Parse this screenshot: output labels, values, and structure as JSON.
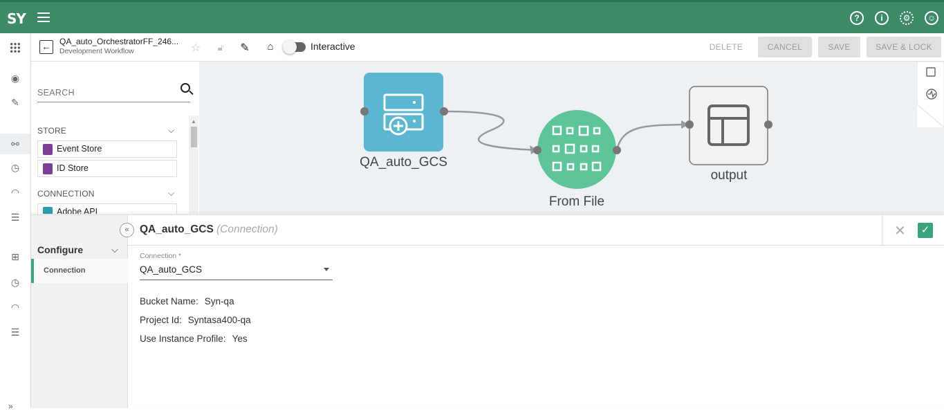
{
  "app": {
    "logo_text": "SY"
  },
  "topbar": {
    "icons": [
      "help-icon",
      "info-icon",
      "settings-icon",
      "account-icon"
    ]
  },
  "toolbar": {
    "title": "QA_auto_OrchestratorFF_246...",
    "subtitle": "Development Workflow",
    "toggle_label": "Interactive",
    "toggle_on": false,
    "delete_label": "DELETE",
    "cancel_label": "CANCEL",
    "save_label": "SAVE",
    "save_lock_label": "SAVE & LOCK"
  },
  "palette": {
    "search_placeholder": "SEARCH",
    "sections": [
      {
        "title": "STORE",
        "items": [
          "Event Store",
          "ID Store"
        ]
      },
      {
        "title": "CONNECTION",
        "items": [
          "Adobe API"
        ]
      }
    ]
  },
  "canvas": {
    "nodes": [
      {
        "label": "QA_auto_GCS",
        "kind": "connection",
        "color": "#5bb6cf"
      },
      {
        "label": "From File",
        "kind": "process",
        "color": "#5ec49a"
      },
      {
        "label": "output",
        "kind": "output",
        "color": "#f2f2f2"
      }
    ]
  },
  "config": {
    "side_heading": "Configure",
    "side_item": "Connection",
    "panel_title": "QA_auto_GCS",
    "panel_type": "(Connection)",
    "field_label": "Connection *",
    "field_value": "QA_auto_GCS",
    "details": [
      {
        "key": "Bucket Name:",
        "value": "Syn-qa"
      },
      {
        "key": "Project Id:",
        "value": "Syntasa400-qa"
      },
      {
        "key": "Use Instance Profile:",
        "value": "Yes"
      }
    ]
  },
  "colors": {
    "brand": "#3d8a68",
    "accent": "#3aa57c"
  }
}
